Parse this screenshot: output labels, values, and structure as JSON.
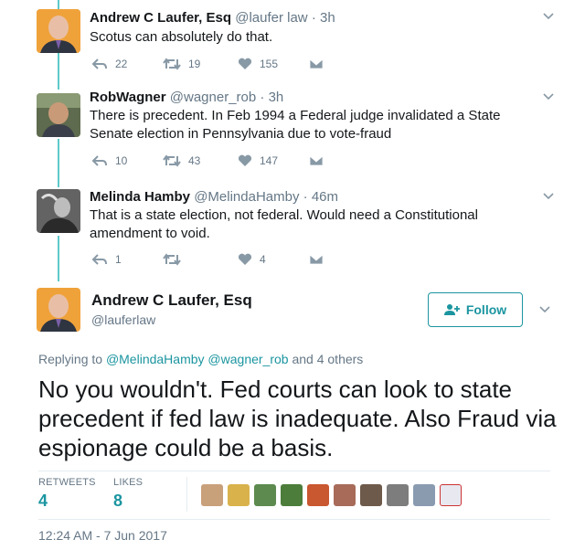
{
  "tweets": [
    {
      "name": "Andrew C Laufer, Esq",
      "handle": "@laufer law",
      "time": "· 3h",
      "text": "Scotus can absolutely do that.",
      "replies": "22",
      "retweets": "19",
      "likes": "155"
    },
    {
      "name": "RobWagner",
      "handle": "@wagner_rob",
      "time": "· 3h",
      "text": "There is precedent. In Feb 1994 a Federal judge invalidated a State Senate election in Pennsylvania due to vote-fraud",
      "replies": "10",
      "retweets": "43",
      "likes": "147"
    },
    {
      "name": "Melinda Hamby",
      "handle": "@MelindaHamby",
      "time": "· 46m",
      "text": "That is a state election, not federal. Would need a Constitutional amendment to void.",
      "replies": "1",
      "retweets": "",
      "likes": "4"
    }
  ],
  "main": {
    "name": "Andrew C Laufer, Esq",
    "handle": "@lauferlaw",
    "follow_label": "Follow",
    "replying_prefix": "Replying to",
    "mention1": "@MelindaHamby",
    "mention2": "@wagner_rob",
    "replying_suffix": "and 4 others",
    "text": "No you wouldn't.  Fed courts can look to state precedent if fed law is inadequate.  Also Fraud via espionage could be a basis.",
    "retweets_label": "RETWEETS",
    "retweets_count": "4",
    "likes_label": "LIKES",
    "likes_count": "8",
    "timestamp": "12:24 AM - 7 Jun 2017"
  },
  "colors": {
    "accent": "#1b95a0",
    "thread": "#5ec9c9",
    "muted": "#657786"
  },
  "likers": [
    "liker-avatar",
    "liker-avatar",
    "liker-avatar",
    "liker-avatar",
    "liker-avatar",
    "liker-avatar",
    "liker-avatar",
    "liker-avatar",
    "liker-avatar",
    "liker-avatar"
  ]
}
